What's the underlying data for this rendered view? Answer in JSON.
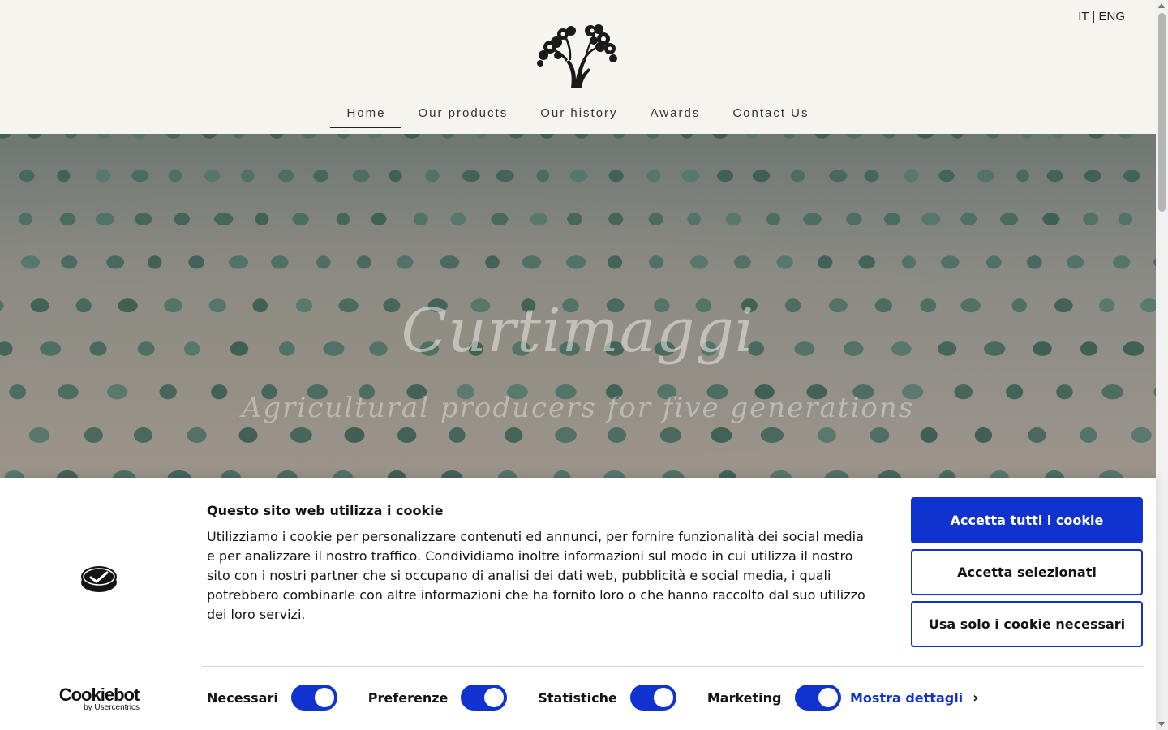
{
  "header": {
    "lang_switch": "IT | ENG",
    "logo_icon": "olive-tree-logo",
    "nav": [
      {
        "label": "Home",
        "active": true
      },
      {
        "label": "Our products",
        "active": false
      },
      {
        "label": "Our history",
        "active": false
      },
      {
        "label": "Awards",
        "active": false
      },
      {
        "label": "Contact Us",
        "active": false
      }
    ]
  },
  "hero": {
    "title": "Curtimaggi",
    "subtitle": "Agricultural producers for five generations"
  },
  "cookie_banner": {
    "title": "Questo sito web utilizza i cookie",
    "body": "Utilizziamo i cookie per personalizzare contenuti ed annunci, per fornire funzionalità dei social media e per analizzare il nostro traffico. Condividiamo inoltre informazioni sul modo in cui utilizza il nostro sito con i nostri partner che si occupano di analisi dei dati web, pubblicità e social media, i quali potrebbero combinarle con altre informazioni che ha fornito loro o che hanno raccolto dal suo utilizzo dei loro servizi.",
    "brand": "Cookiebot",
    "brand_by": "by Usercentrics",
    "buttons": {
      "accept_all": "Accetta tutti i cookie",
      "accept_selected": "Accetta selezionati",
      "necessary_only": "Usa solo i cookie necessari"
    },
    "toggles": [
      {
        "label": "Necessari",
        "on": true
      },
      {
        "label": "Preferenze",
        "on": true
      },
      {
        "label": "Statistiche",
        "on": true
      },
      {
        "label": "Marketing",
        "on": true
      }
    ],
    "show_details": "Mostra dettagli",
    "accent_color": "#1032cf"
  }
}
